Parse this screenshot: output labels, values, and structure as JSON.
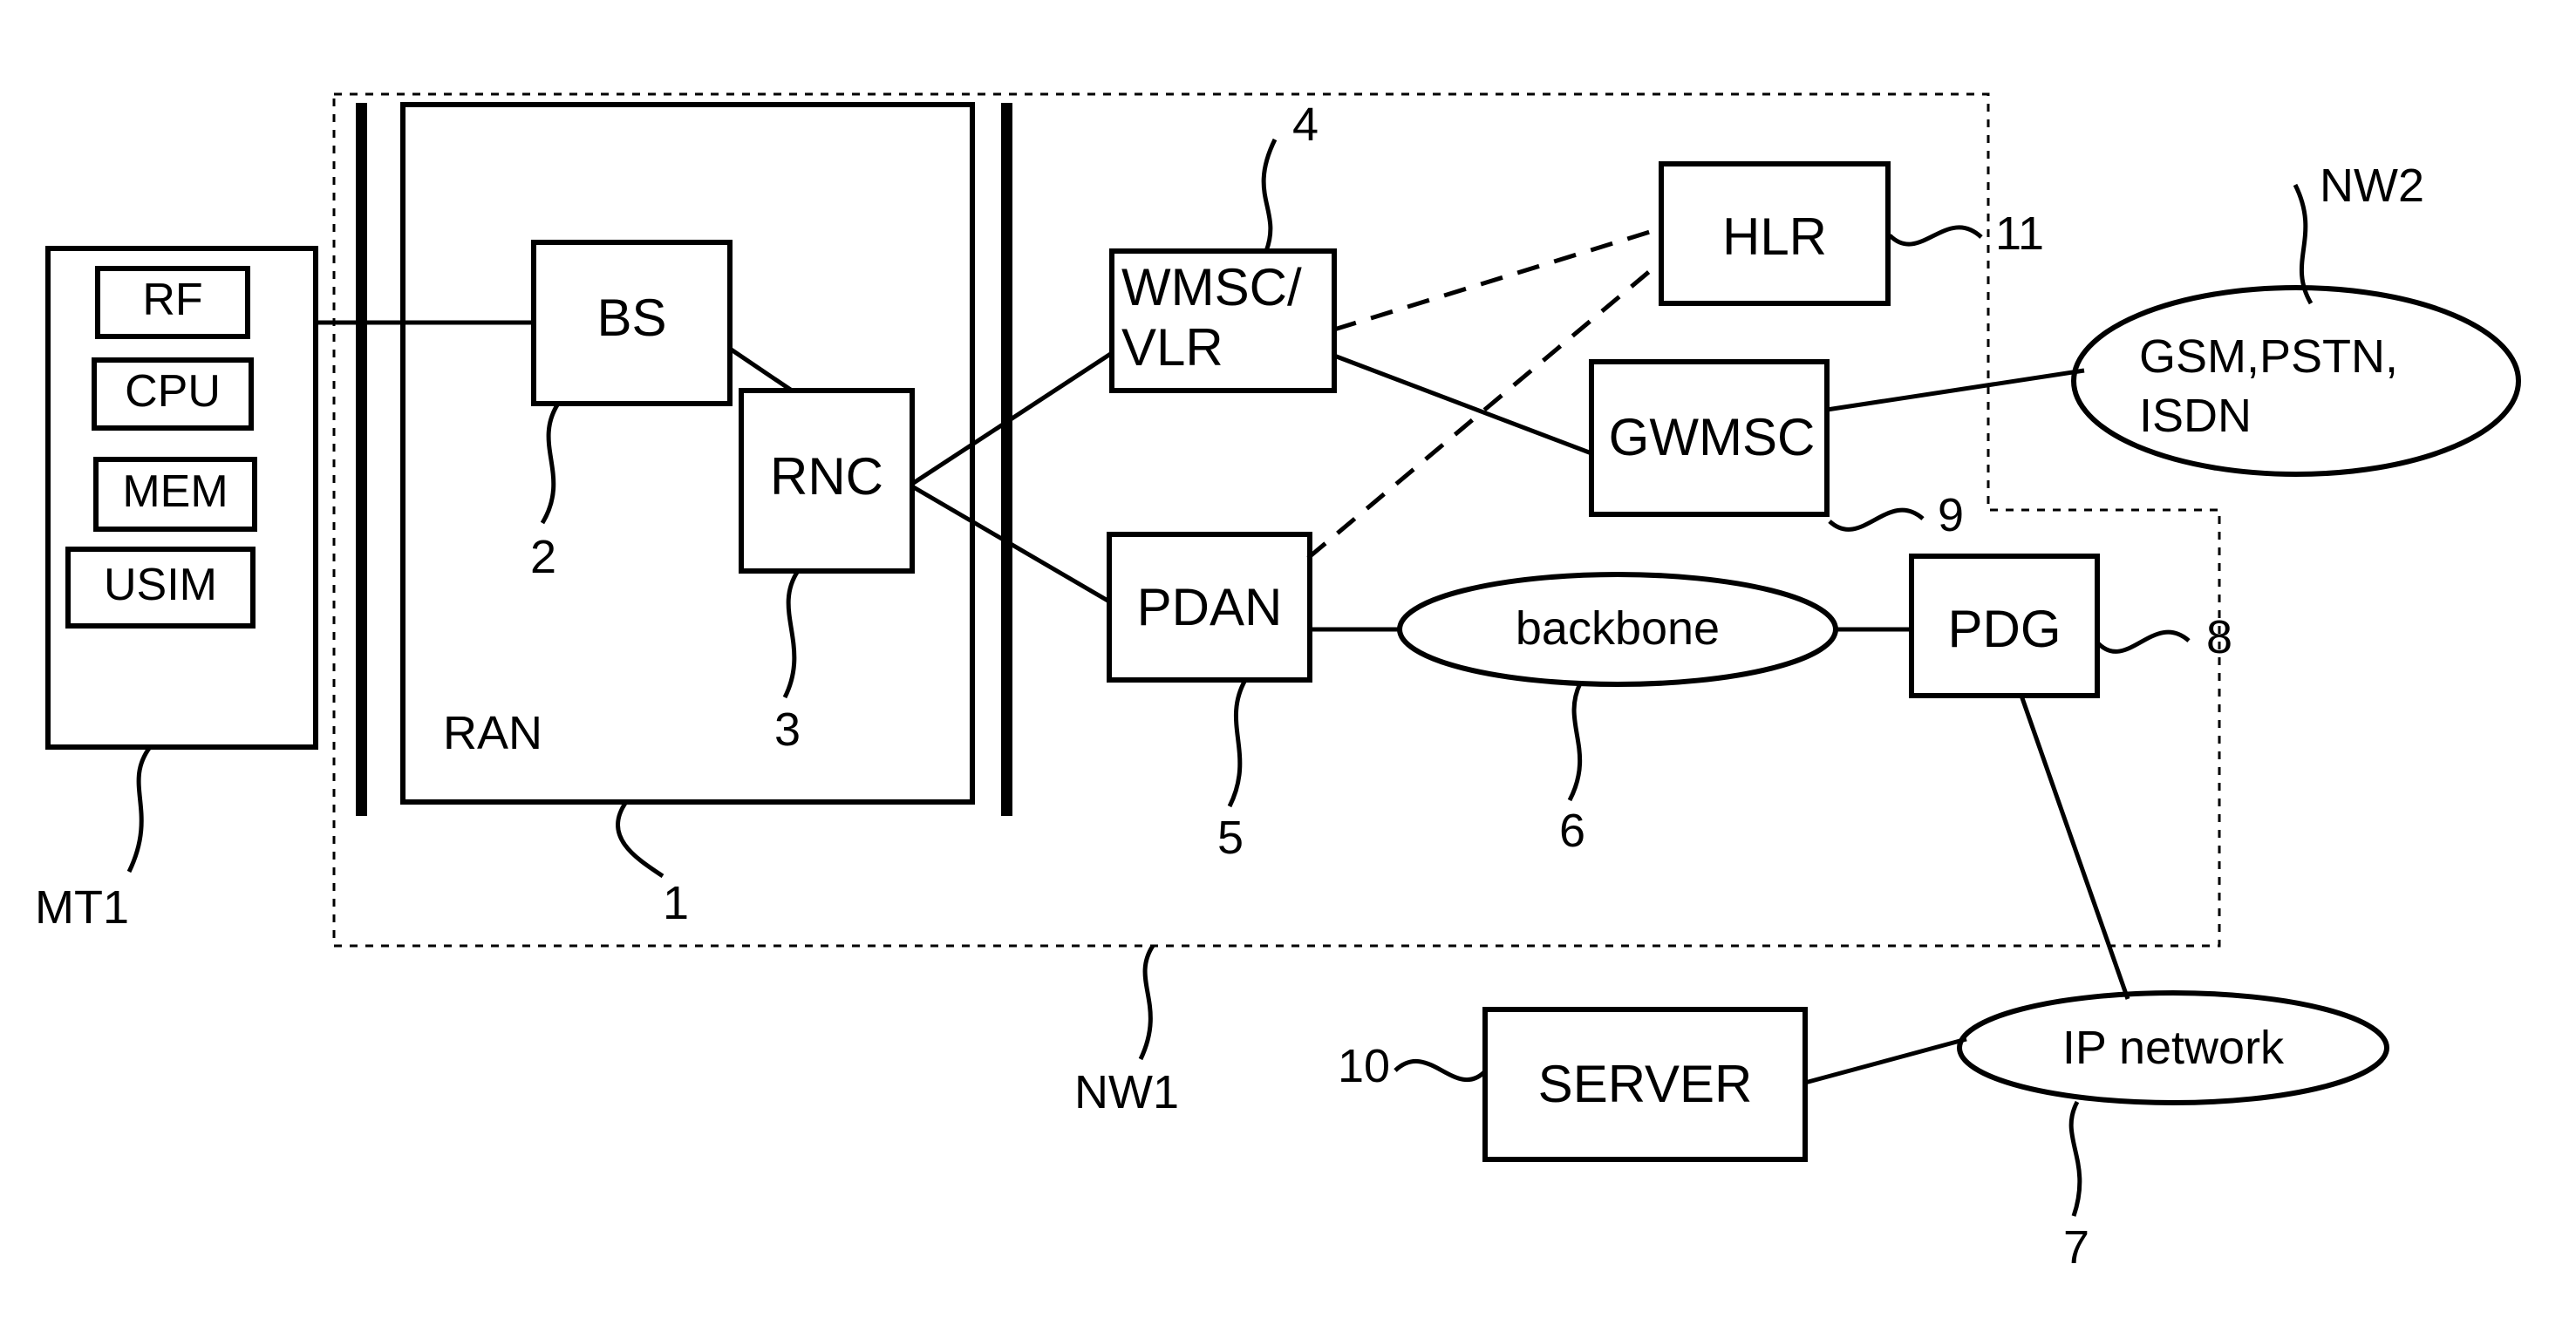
{
  "figure": {
    "type": "patent-network-architecture-diagram",
    "title": "",
    "description": "Mobile terminal MT1 connected via RAN to core network NW1 and external network NW2"
  },
  "regions": [
    {
      "id": "nw1",
      "label": "NW1",
      "style": "dashed-boundary"
    },
    {
      "id": "ran",
      "label": "RAN",
      "style": "solid-box"
    }
  ],
  "terminal": {
    "label": "MT1",
    "modules": [
      {
        "label": "RF"
      },
      {
        "label": "CPU"
      },
      {
        "label": "MEM"
      },
      {
        "label": "USIM"
      }
    ]
  },
  "nodes": [
    {
      "id": "bs",
      "label": "BS",
      "shape": "rect",
      "ref": "2"
    },
    {
      "id": "rnc",
      "label": "RNC",
      "shape": "rect",
      "ref": "3"
    },
    {
      "id": "wmsc",
      "label": "WMSC/\nVLR",
      "line1": "WMSC/",
      "line2": "VLR",
      "shape": "rect",
      "ref": "4"
    },
    {
      "id": "hlr",
      "label": "HLR",
      "shape": "rect",
      "ref": "11"
    },
    {
      "id": "gwmsc",
      "label": "GWMSC",
      "shape": "rect",
      "ref": "9"
    },
    {
      "id": "pdan",
      "label": "PDAN",
      "shape": "rect",
      "ref": "5"
    },
    {
      "id": "backbone",
      "label": "backbone",
      "shape": "ellipse",
      "ref": "6"
    },
    {
      "id": "pdg",
      "label": "PDG",
      "shape": "rect",
      "ref": "8"
    },
    {
      "id": "server",
      "label": "SERVER",
      "shape": "rect",
      "ref": "10"
    },
    {
      "id": "ipnet",
      "label": "IP network",
      "shape": "ellipse",
      "ref": "7"
    },
    {
      "id": "nw2",
      "label": "GSM,PSTN,\nISDN",
      "line1": "GSM,PSTN,",
      "line2": "ISDN",
      "shape": "ellipse",
      "ref": "NW2"
    }
  ],
  "reference_numerals": {
    "ran": "1",
    "bs": "2",
    "rnc": "3",
    "wmsc_vlr": "4",
    "pdan": "5",
    "backbone": "6",
    "ip_network": "7",
    "pdg": "8",
    "gwmsc": "9",
    "server": "10",
    "hlr": "11",
    "network_1": "NW1",
    "network_2": "NW2",
    "mobile_terminal": "MT1"
  },
  "connections": [
    {
      "from": "mt1",
      "to": "bs",
      "style": "solid"
    },
    {
      "from": "bs",
      "to": "rnc",
      "style": "solid"
    },
    {
      "from": "rnc",
      "to": "wmsc",
      "style": "solid"
    },
    {
      "from": "rnc",
      "to": "pdan",
      "style": "solid"
    },
    {
      "from": "wmsc",
      "to": "hlr",
      "style": "dashed"
    },
    {
      "from": "wmsc",
      "to": "gwmsc",
      "style": "solid"
    },
    {
      "from": "pdan",
      "to": "hlr",
      "style": "dashed"
    },
    {
      "from": "pdan",
      "to": "backbone",
      "style": "solid"
    },
    {
      "from": "backbone",
      "to": "pdg",
      "style": "solid"
    },
    {
      "from": "gwmsc",
      "to": "nw2",
      "style": "solid"
    },
    {
      "from": "pdg",
      "to": "ipnet",
      "style": "solid"
    },
    {
      "from": "server",
      "to": "ipnet",
      "style": "solid"
    }
  ],
  "colors": {
    "ink": "#000000",
    "paper": "#ffffff"
  }
}
